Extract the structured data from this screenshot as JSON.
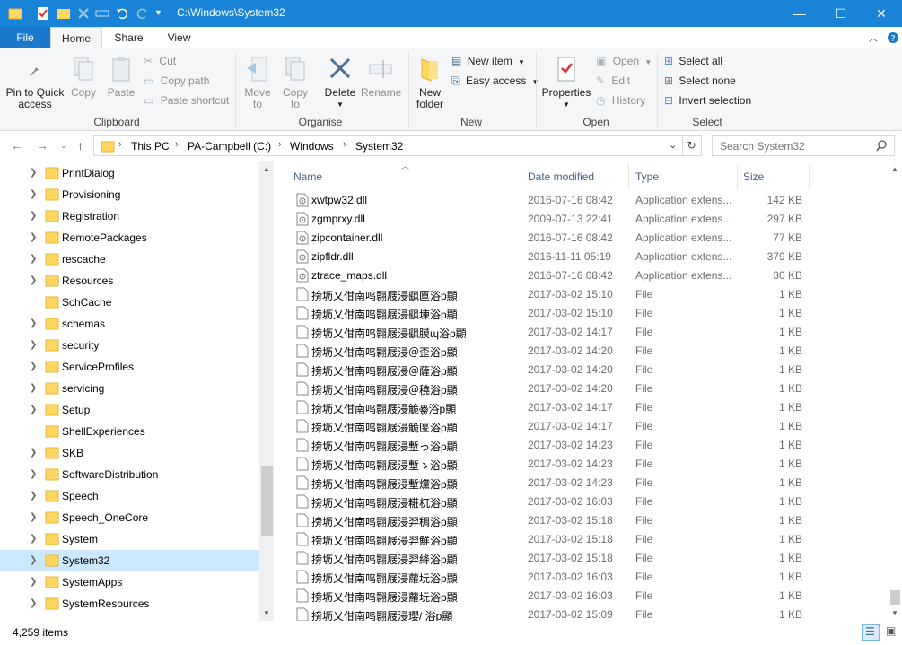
{
  "window": {
    "title": "C:\\Windows\\System32",
    "minimize_glyph": "—",
    "maximize_glyph": "☐",
    "close_glyph": "✕"
  },
  "tabs": [
    {
      "label": "File"
    },
    {
      "label": "Home"
    },
    {
      "label": "Share"
    },
    {
      "label": "View"
    }
  ],
  "ribbon": {
    "clipboard": {
      "label": "Clipboard",
      "pin": "Pin to Quick access",
      "pin_line1": "Pin to Quick",
      "pin_line2": "access",
      "copy": "Copy",
      "paste": "Paste",
      "cut": "Cut",
      "copy_path": "Copy path",
      "paste_shortcut": "Paste shortcut"
    },
    "organise": {
      "label": "Organise",
      "move_to": "Move to",
      "move_line1": "Move",
      "move_line2": "to",
      "copy_to": "Copy to",
      "copy_line1": "Copy",
      "copy_line2": "to",
      "delete": "Delete",
      "rename": "Rename"
    },
    "new": {
      "label": "New",
      "new_folder_line1": "New",
      "new_folder_line2": "folder",
      "new_item": "New item",
      "easy_access": "Easy access"
    },
    "open": {
      "label": "Open",
      "properties": "Properties",
      "open": "Open",
      "edit": "Edit",
      "history": "History"
    },
    "select": {
      "label": "Select",
      "select_all": "Select all",
      "select_none": "Select none",
      "invert_selection": "Invert selection"
    }
  },
  "address": {
    "crumbs": [
      "This PC",
      "PA-Campbell (C:)",
      "Windows",
      "System32"
    ],
    "search_placeholder": "Search System32"
  },
  "nav": {
    "items": [
      {
        "label": "PrintDialog"
      },
      {
        "label": "Provisioning"
      },
      {
        "label": "Registration"
      },
      {
        "label": "RemotePackages"
      },
      {
        "label": "rescache"
      },
      {
        "label": "Resources"
      },
      {
        "label": "SchCache"
      },
      {
        "label": "schemas"
      },
      {
        "label": "security"
      },
      {
        "label": "ServiceProfiles"
      },
      {
        "label": "servicing"
      },
      {
        "label": "Setup"
      },
      {
        "label": "ShellExperiences"
      },
      {
        "label": "SKB"
      },
      {
        "label": "SoftwareDistribution"
      },
      {
        "label": "Speech"
      },
      {
        "label": "Speech_OneCore"
      },
      {
        "label": "System"
      },
      {
        "label": "System32",
        "selected": true
      },
      {
        "label": "SystemApps"
      },
      {
        "label": "SystemResources"
      }
    ]
  },
  "list": {
    "columns": {
      "name": "Name",
      "date": "Date modified",
      "type": "Type",
      "size": "Size"
    },
    "rows": [
      {
        "name": "xwtpw32.dll",
        "date": "2016-07-16 08:42",
        "type": "Application extens...",
        "size": "142 KB",
        "icon": "dll-icon"
      },
      {
        "name": "zgmprxy.dll",
        "date": "2009-07-13 22:41",
        "type": "Application extens...",
        "size": "297 KB",
        "icon": "dll-icon"
      },
      {
        "name": "zipcontainer.dll",
        "date": "2016-07-16 08:42",
        "type": "Application extens...",
        "size": "77 KB",
        "icon": "dll-icon"
      },
      {
        "name": "zipfldr.dll",
        "date": "2016-11-11 05:19",
        "type": "Application extens...",
        "size": "379 KB",
        "icon": "dll-icon"
      },
      {
        "name": "ztrace_maps.dll",
        "date": "2016-07-16 08:42",
        "type": "Application extens...",
        "size": "30 KB",
        "icon": "dll-icon"
      },
      {
        "name": "搒坜乂佄南呜翾屐浸飖匰浴p顯",
        "date": "2017-03-02 15:10",
        "type": "File",
        "size": "1 KB",
        "icon": "file-icon"
      },
      {
        "name": "搒坜乂佄南呜翾屐浸飖埬浴p顯",
        "date": "2017-03-02 15:10",
        "type": "File",
        "size": "1 KB",
        "icon": "file-icon"
      },
      {
        "name": "搒坜乂佄南呜翾屐浸飖膜ɰ浴p顯",
        "date": "2017-03-02 14:17",
        "type": "File",
        "size": "1 KB",
        "icon": "file-icon"
      },
      {
        "name": "搒坜乂佄南呜翾屐浸＠歪浴p顯",
        "date": "2017-03-02 14:20",
        "type": "File",
        "size": "1 KB",
        "icon": "file-icon"
      },
      {
        "name": "搒坜乂佄南呜翾屐浸＠薩浴p顯",
        "date": "2017-03-02 14:20",
        "type": "File",
        "size": "1 KB",
        "icon": "file-icon"
      },
      {
        "name": "搒坜乂佄南呜翾屐浸＠穘浴p顯",
        "date": "2017-03-02 14:20",
        "type": "File",
        "size": "1 KB",
        "icon": "file-icon"
      },
      {
        "name": "搒坜乂佄南呜翾屐浸觤ꙮ浴p顯",
        "date": "2017-03-02 14:17",
        "type": "File",
        "size": "1 KB",
        "icon": "file-icon"
      },
      {
        "name": "搒坜乂佄南呜翾屐浸觤匽浴p顯",
        "date": "2017-03-02 14:17",
        "type": "File",
        "size": "1 KB",
        "icon": "file-icon"
      },
      {
        "name": "搒坜乂佄南呜翾屐浸塹っ浴p顯",
        "date": "2017-03-02 14:23",
        "type": "File",
        "size": "1 KB",
        "icon": "file-icon"
      },
      {
        "name": "搒坜乂佄南呜翾屐浸塹ゝ浴p顯",
        "date": "2017-03-02 14:23",
        "type": "File",
        "size": "1 KB",
        "icon": "file-icon"
      },
      {
        "name": "搒坜乂佄南呜翾屐浸塹爣浴p顯",
        "date": "2017-03-02 14:23",
        "type": "File",
        "size": "1 KB",
        "icon": "file-icon"
      },
      {
        "name": "搒坜乂佄南呜翾屐浸糚杌浴p顯",
        "date": "2017-03-02 16:03",
        "type": "File",
        "size": "1 KB",
        "icon": "file-icon"
      },
      {
        "name": "搒坜乂佄南呜翾屐浸羿稠浴p顯",
        "date": "2017-03-02 15:18",
        "type": "File",
        "size": "1 KB",
        "icon": "file-icon"
      },
      {
        "name": "搒坜乂佄南呜翾屐浸羿鮮浴p顯",
        "date": "2017-03-02 15:18",
        "type": "File",
        "size": "1 KB",
        "icon": "file-icon"
      },
      {
        "name": "搒坜乂佄南呜翾屐浸羿絳浴p顯",
        "date": "2017-03-02 15:18",
        "type": "File",
        "size": "1 KB",
        "icon": "file-icon"
      },
      {
        "name": "搒坜乂佄南呜翾屐浸蘿坃浴p顯",
        "date": "2017-03-02 16:03",
        "type": "File",
        "size": "1 KB",
        "icon": "file-icon"
      },
      {
        "name": "搒坜乂佄南呜翾屐浸蘿坃浴p顯",
        "date": "2017-03-02 16:03",
        "type": "File",
        "size": "1 KB",
        "icon": "file-icon"
      },
      {
        "name": "搒坜乂佄南呜翾屐浸瓔/ 浴p顯",
        "date": "2017-03-02 15:09",
        "type": "File",
        "size": "1 KB",
        "icon": "file-icon"
      }
    ]
  },
  "status": {
    "item_count": "4,259 items"
  },
  "colors": {
    "titlebar": "#1883d7",
    "file_tab": "#1979ca",
    "selection": "#cce8ff",
    "folder": "#ffd662"
  }
}
